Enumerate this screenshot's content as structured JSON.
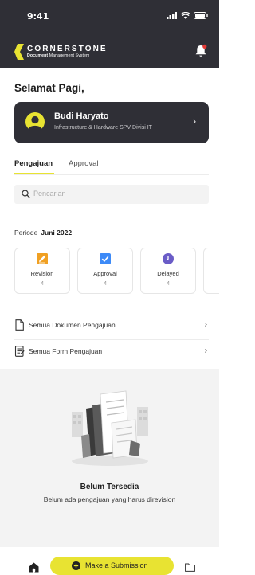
{
  "status_bar": {
    "time": "9:41"
  },
  "brand": {
    "name": "CORNERSTONE",
    "sub_bold": "Document",
    "sub_rest": " Management System"
  },
  "greeting": "Selamat Pagi,",
  "profile": {
    "name": "Budi Haryato",
    "role": "Infrastructure & Hardware SPV Divisi IT"
  },
  "tabs": [
    {
      "label": "Pengajuan",
      "active": true
    },
    {
      "label": "Approval",
      "active": false
    }
  ],
  "search": {
    "placeholder": "Pencarian"
  },
  "periode": {
    "label": "Periode",
    "value": "Juni 2022"
  },
  "cards": [
    {
      "label": "Revision",
      "count": "4",
      "icon": "edit-icon",
      "color": "#f0a023"
    },
    {
      "label": "Approval",
      "count": "4",
      "icon": "check-icon",
      "color": "#3d8af7"
    },
    {
      "label": "Delayed",
      "count": "4",
      "icon": "clock-icon",
      "color": "#6a5cc7"
    }
  ],
  "links": [
    {
      "label": "Semua Dokumen Pengajuan",
      "icon": "document-icon"
    },
    {
      "label": "Semua Form Pengajuan",
      "icon": "form-icon"
    }
  ],
  "empty_state": {
    "title": "Belum Tersedia",
    "subtitle": "Belum ada pengajuan yang harus direvision"
  },
  "bottom_nav": {
    "submit_label": "Make a Submission"
  },
  "colors": {
    "dark": "#2f2f36",
    "accent": "#e8e332",
    "notification": "#e53935"
  }
}
